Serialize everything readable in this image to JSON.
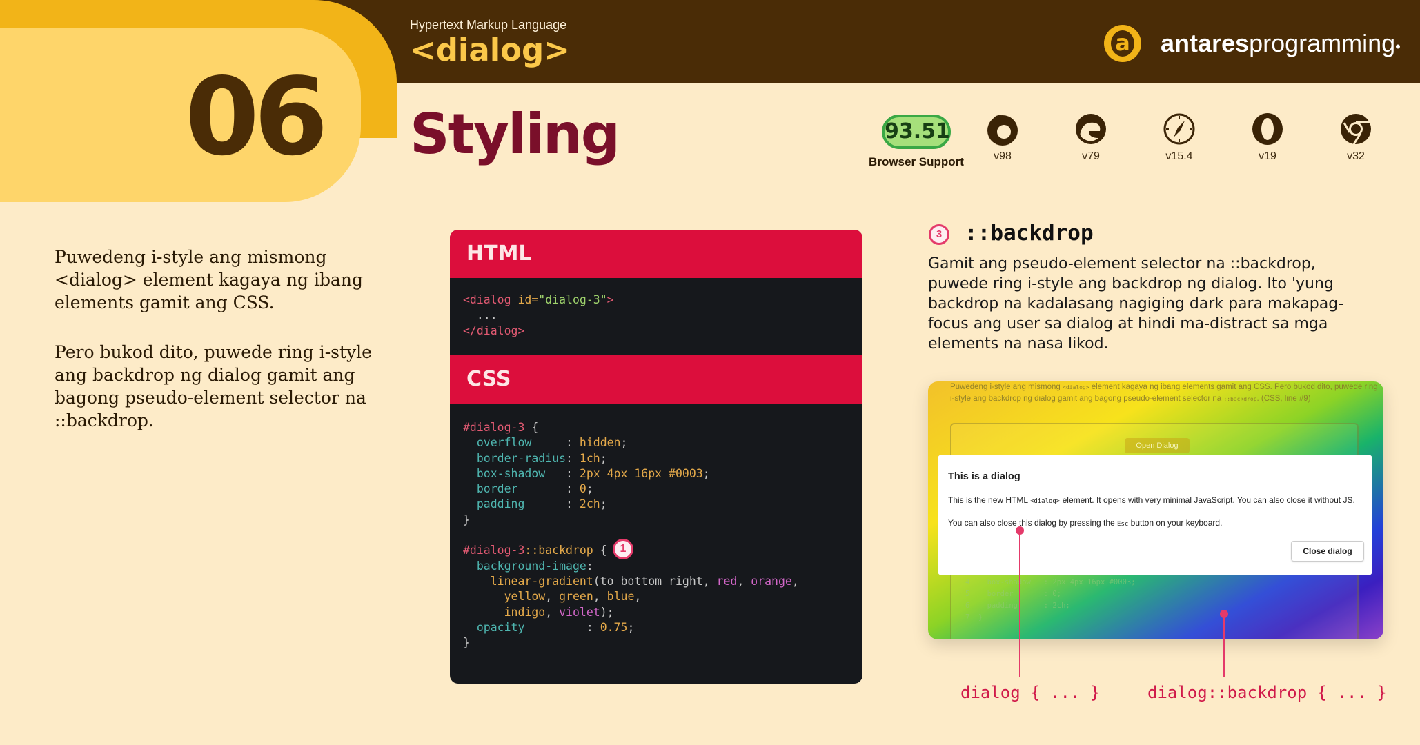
{
  "header": {
    "subtitle": "Hypertext Markup Language",
    "element": "<dialog>",
    "brand_bold": "antares",
    "brand_regular": "programming",
    "brand_dot": "•",
    "logo_glyph": "a"
  },
  "section": {
    "number": "06",
    "title": "Styling"
  },
  "support": {
    "score": "93.51",
    "label": "Browser Support",
    "browsers": [
      {
        "icon": "firefox-icon",
        "version": "v98"
      },
      {
        "icon": "edge-icon",
        "version": "v79"
      },
      {
        "icon": "safari-icon",
        "version": "v15.4"
      },
      {
        "icon": "opera-icon",
        "version": "v19"
      },
      {
        "icon": "chrome-icon",
        "version": "v32"
      }
    ]
  },
  "left": {
    "para1": "Puwedeng i-style ang mismong <dialog> element kagaya ng ibang elements gamit ang CSS.",
    "para2": "Pero bukod dito, puwede ring i-style ang backdrop ng dialog gamit ang bagong pseudo-element selector na ::backdrop."
  },
  "code": {
    "html_label": "HTML",
    "css_label": "CSS",
    "html": {
      "open_a": "<dialog ",
      "attr": "id=",
      "attr_val": "\"dialog-3\"",
      "open_b": ">",
      "dots": "  ...",
      "close": "</dialog>"
    },
    "css1": {
      "selector": "#dialog-3",
      "brace_open": " {",
      "rules": [
        {
          "prop": "  overflow     ",
          "val": "hidden"
        },
        {
          "prop": "  border-radius",
          "val": "1ch"
        },
        {
          "prop": "  box-shadow   ",
          "val": "2px 4px 16px #0003"
        },
        {
          "prop": "  border       ",
          "val": "0"
        },
        {
          "prop": "  padding      ",
          "val": "2ch"
        }
      ],
      "brace_close": "}"
    },
    "css2": {
      "selector_a": "#dialog-3",
      "selector_b": "::backdrop",
      "brace_open": " {",
      "bg_prop": "  background-image",
      "fn_name": "    linear-gradient",
      "fn_args1": "(to bottom right, ",
      "c_red": "red",
      "c_orange": "orange",
      "c_yellow": "yellow",
      "c_green": "green",
      "c_blue": "blue",
      "c_indigo": "indigo",
      "c_violet": "violet",
      "op_prop": "  opacity         ",
      "op_val": "0.75",
      "brace_close": "}"
    },
    "marker": "1"
  },
  "right": {
    "marker": "3",
    "title": "::backdrop",
    "text": "Gamit ang pseudo-element selector na ::backdrop, puwede ring i-style ang backdrop ng dialog. Ito 'yung backdrop na kadalasang nagiging dark para makapag-focus ang user sa dialog at hindi ma-distract sa mga elements na nasa likod."
  },
  "demo": {
    "bg_text_a": "Puwedeng i-style ang mismong ",
    "bg_text_code1": "<dialog>",
    "bg_text_b": " element kagaya ng ibang elements gamit ang CSS. Pero bukod dito, puwede ring i-style ang backdrop ng dialog gamit ang bagong pseudo-element selector na ",
    "bg_text_code2": "::backdrop",
    "bg_text_c": ". (CSS, line #9)",
    "open_button": "Open Dialog",
    "bg_code": "3    border-radius: 1ch;\n4    box-shadow   : 2px 4px 16px #0003;\n5    border       : 0;\n6    padding      : 2ch;\n7  }",
    "dialog_title": "This is a dialog",
    "dialog_p1_a": "This is the new HTML ",
    "dialog_p1_code": "<dialog>",
    "dialog_p1_b": " element. It opens with very minimal JavaScript. You can also close it without JS.",
    "dialog_p2_a": "You can also close this dialog by pressing the ",
    "dialog_p2_code": "Esc",
    "dialog_p2_b": " button on your keyboard.",
    "close_button": "Close dialog"
  },
  "pointers": {
    "dialog_label": "dialog { ... }",
    "backdrop_label": "dialog::backdrop { ... }"
  },
  "colors": {
    "topbar": "#4a2c06",
    "accent_red": "#dc0e3c",
    "heading": "#7a0f2a",
    "background": "#fdebc8"
  }
}
